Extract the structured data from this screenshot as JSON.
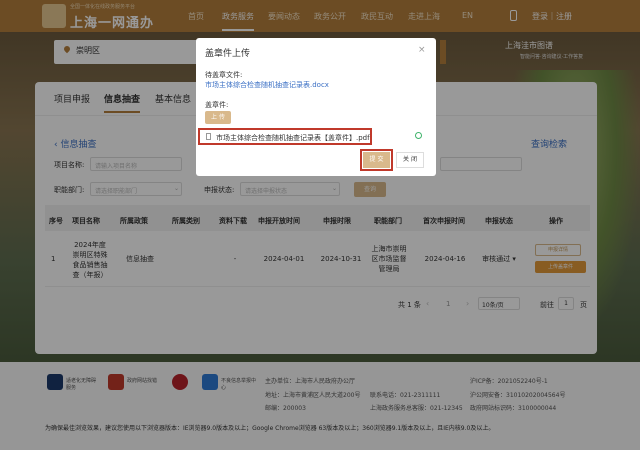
{
  "header": {
    "logo_sub": "全国一体化在线政务服务平台",
    "logo_title": "上海一网通办",
    "nav": [
      "首页",
      "政务服务",
      "要闻动态",
      "政务公开",
      "政民互动",
      "走进上海",
      "EN"
    ],
    "active_nav": "政务服务",
    "login": "登录｜注册"
  },
  "banner": {
    "district": "崇明区",
    "helper": "上海洼市图谱",
    "helper_sub": "智能问答·咨询建议·工作答复"
  },
  "tabs": [
    "项目申报",
    "信息抽查",
    "基本信息"
  ],
  "active_tab": "信息抽查",
  "page": {
    "back_label": "信息抽查",
    "right_link": "查询检索"
  },
  "filters": {
    "project_name_label": "项目名称:",
    "project_name_placeholder": "请输入项目名称",
    "dept_label": "职能部门:",
    "dept_placeholder": "请选择职能部门",
    "status_label": "申报状态:",
    "status_placeholder": "请选择申报状态",
    "query_button": "查询"
  },
  "table": {
    "headers": [
      "序号",
      "项目名称",
      "所属政策",
      "所属类别",
      "资料下载",
      "申报开放时间",
      "申报时限",
      "职能部门",
      "首次申报时间",
      "申报状态",
      "操作"
    ],
    "rows": [
      {
        "no": "1",
        "name": "2024年度崇明区特殊食品销售抽查（年报）",
        "policy": "信息抽查",
        "category": "",
        "download": "-",
        "open_date": "2024-04-01",
        "deadline": "2024-10-31",
        "dept": "上海市崇明区市场监督管理局",
        "first_date": "2024-04-16",
        "status": "审核通过",
        "ops": [
          "申报详情",
          "上传盖章件"
        ]
      }
    ]
  },
  "pager": {
    "total": "共 1 条",
    "current": "1",
    "page_size": "10条/页",
    "goto": "前往",
    "goto_value": "1",
    "page_unit": "页"
  },
  "footer": {
    "badges": [
      "适老化无障碍服务",
      "政府网站找错",
      "",
      "不良信息举报中心"
    ],
    "host": "主办单位：上海市人民政府办公厅",
    "address": "地址：上海市黄浦区人民大道200号",
    "postcode": "邮编：200003",
    "phone": "联系电话：021-2311111",
    "complaint": "上海政务服务总客服：021-12345",
    "icp": "沪ICP备：2021052240号-1",
    "police": "沪公网安备：31010202004564号",
    "site_code": "政府网站标识码：3100000044",
    "browser_note": "为确保最佳浏览效果，建议您使用以下浏览器版本：IE浏览器9.0版本及以上；Google Chrome浏览器 63版本及以上；360浏览器9.1版本及以上，且IE内核9.0及以上。"
  },
  "modal": {
    "title": "盖章件上传",
    "close": "×",
    "file_label": "待盖章文件:",
    "file_name": "市场主体综合检查随机抽查记录表.docx",
    "stamped_label": "盖章件:",
    "upload_button": "上 传",
    "selected_file": "市场主体综合检查随机抽查记录表【盖章件】.pdf",
    "submit_button": "提 交",
    "cancel_button": "关 闭"
  }
}
